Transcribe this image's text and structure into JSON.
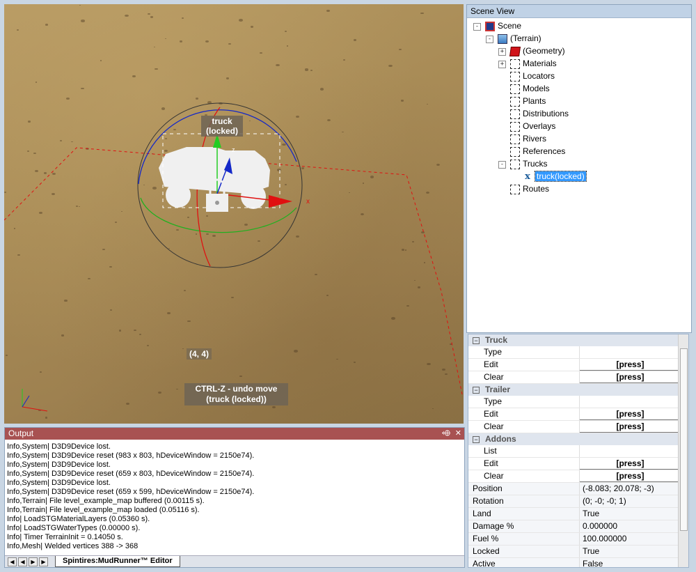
{
  "viewport": {
    "selected_label": "truck\n(locked)",
    "coords": "(4, 4)",
    "undo_hint": "CTRL-Z - undo move (truck (locked))",
    "axis_x": "x",
    "axis_z": "z"
  },
  "scene_view": {
    "title": "Scene View",
    "items": [
      {
        "label": "Scene",
        "icon": "scene-icon"
      },
      {
        "label": "(Terrain)",
        "icon": "terrain-icon"
      },
      {
        "label": "(Geometry)",
        "icon": "geometry-icon"
      },
      {
        "label": "Materials",
        "icon": "folder-icon"
      },
      {
        "label": "Locators",
        "icon": "folder-icon"
      },
      {
        "label": "Models",
        "icon": "folder-icon"
      },
      {
        "label": "Plants",
        "icon": "folder-icon"
      },
      {
        "label": "Distributions",
        "icon": "folder-icon"
      },
      {
        "label": "Overlays",
        "icon": "folder-icon"
      },
      {
        "label": "Rivers",
        "icon": "folder-icon"
      },
      {
        "label": "References",
        "icon": "folder-icon"
      },
      {
        "label": "Trucks",
        "icon": "folder-icon"
      },
      {
        "label": "truck(locked)",
        "icon": "truck-icon"
      },
      {
        "label": "Routes",
        "icon": "folder-icon"
      }
    ]
  },
  "properties": {
    "categories": [
      {
        "name": "Truck",
        "rows": [
          {
            "name": "Type",
            "value": ""
          },
          {
            "name": "Edit",
            "value": "[press]"
          },
          {
            "name": "Clear",
            "value": "[press]"
          }
        ]
      },
      {
        "name": "Trailer",
        "rows": [
          {
            "name": "Type",
            "value": ""
          },
          {
            "name": "Edit",
            "value": "[press]"
          },
          {
            "name": "Clear",
            "value": "[press]"
          }
        ]
      },
      {
        "name": "Addons",
        "rows": [
          {
            "name": "List",
            "value": ""
          },
          {
            "name": "Edit",
            "value": "[press]"
          },
          {
            "name": "Clear",
            "value": "[press]"
          }
        ]
      }
    ],
    "fields": [
      {
        "name": "Position",
        "value": "(-8.083; 20.078; -3)"
      },
      {
        "name": "Rotation",
        "value": "(0; -0; -0; 1)"
      },
      {
        "name": "Land",
        "value": "True"
      },
      {
        "name": "Damage %",
        "value": "0.000000"
      },
      {
        "name": "Fuel %",
        "value": "100.000000"
      },
      {
        "name": "Locked",
        "value": "True"
      },
      {
        "name": "Active",
        "value": "False"
      }
    ]
  },
  "output": {
    "title": "Output",
    "pin": "⬲",
    "close": "✕",
    "lines": [
      "Info,System| D3D9Device lost.",
      "Info,System| D3D9Device reset (983 x 803, hDeviceWindow = 2150e74).",
      "Info,System| D3D9Device lost.",
      "Info,System| D3D9Device reset (659 x 803, hDeviceWindow = 2150e74).",
      "Info,System| D3D9Device lost.",
      "Info,System| D3D9Device reset (659 x 599, hDeviceWindow = 2150e74).",
      "Info,Terrain| File level_example_map buffered (0.00115 s).",
      "Info,Terrain| File level_example_map loaded (0.05116 s).",
      "Info| LoadSTGMaterialLayers (0.05360 s).",
      "Info| LoadSTGWaterTypes (0.00000 s).",
      "Info| Timer TerrainInit = 0.14050 s.",
      "Info,Mesh| Welded vertices 388 -> 368"
    ],
    "tab": "Spintires:MudRunner™ Editor"
  }
}
